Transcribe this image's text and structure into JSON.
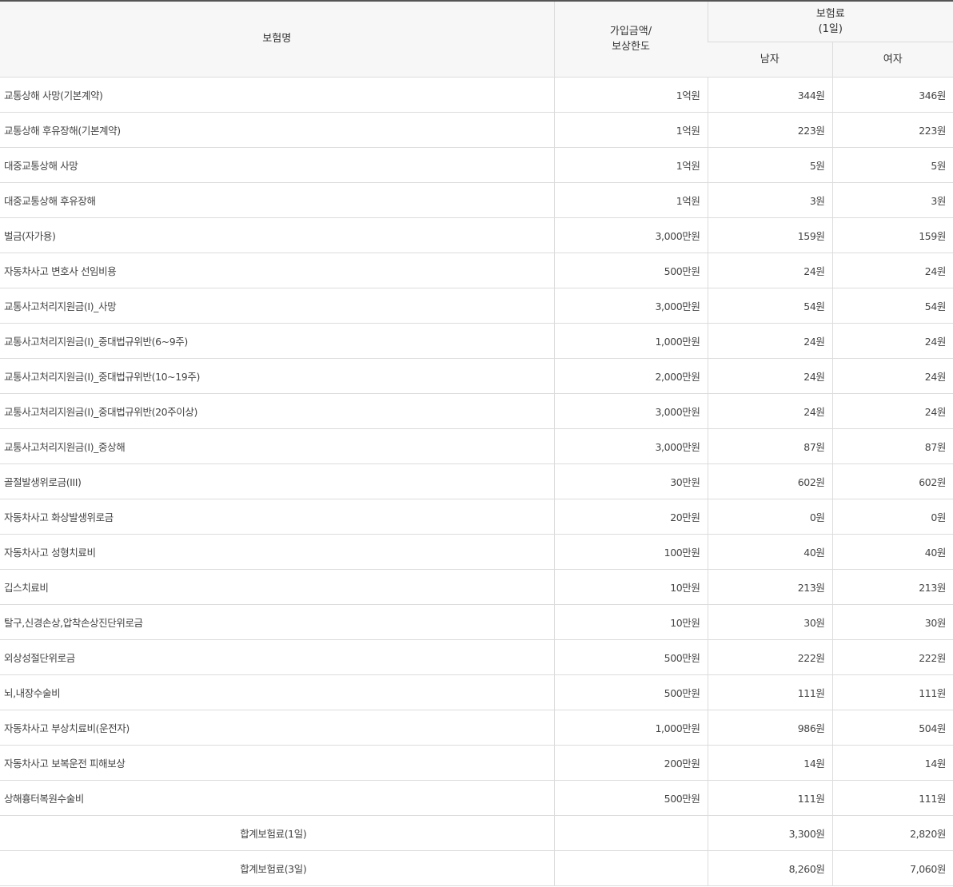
{
  "header": {
    "name": "보험명",
    "amount_line1": "가입금액/",
    "amount_line2": "보상한도",
    "premium_line1": "보험료",
    "premium_line2": "(1일)",
    "male": "남자",
    "female": "여자"
  },
  "rows": [
    {
      "name": "교통상해 사망(기본계약)",
      "amount": "1억원",
      "male": "344원",
      "female": "346원"
    },
    {
      "name": "교통상해 후유장해(기본계약)",
      "amount": "1억원",
      "male": "223원",
      "female": "223원"
    },
    {
      "name": "대중교통상해 사망",
      "amount": "1억원",
      "male": "5원",
      "female": "5원"
    },
    {
      "name": "대중교통상해 후유장해",
      "amount": "1억원",
      "male": "3원",
      "female": "3원"
    },
    {
      "name": "벌금(자가용)",
      "amount": "3,000만원",
      "male": "159원",
      "female": "159원"
    },
    {
      "name": "자동차사고 변호사 선임비용",
      "amount": "500만원",
      "male": "24원",
      "female": "24원"
    },
    {
      "name": "교통사고처리지원금(I)_사망",
      "amount": "3,000만원",
      "male": "54원",
      "female": "54원"
    },
    {
      "name": "교통사고처리지원금(I)_중대법규위반(6~9주)",
      "amount": "1,000만원",
      "male": "24원",
      "female": "24원"
    },
    {
      "name": "교통사고처리지원금(I)_중대법규위반(10~19주)",
      "amount": "2,000만원",
      "male": "24원",
      "female": "24원"
    },
    {
      "name": "교통사고처리지원금(I)_중대법규위반(20주이상)",
      "amount": "3,000만원",
      "male": "24원",
      "female": "24원"
    },
    {
      "name": "교통사고처리지원금(I)_중상해",
      "amount": "3,000만원",
      "male": "87원",
      "female": "87원"
    },
    {
      "name": "골절발생위로금(III)",
      "amount": "30만원",
      "male": "602원",
      "female": "602원"
    },
    {
      "name": "자동차사고 화상발생위로금",
      "amount": "20만원",
      "male": "0원",
      "female": "0원"
    },
    {
      "name": "자동차사고 성형치료비",
      "amount": "100만원",
      "male": "40원",
      "female": "40원"
    },
    {
      "name": "깁스치료비",
      "amount": "10만원",
      "male": "213원",
      "female": "213원"
    },
    {
      "name": "탈구,신경손상,압착손상진단위로금",
      "amount": "10만원",
      "male": "30원",
      "female": "30원"
    },
    {
      "name": "외상성절단위로금",
      "amount": "500만원",
      "male": "222원",
      "female": "222원"
    },
    {
      "name": "뇌,내장수술비",
      "amount": "500만원",
      "male": "111원",
      "female": "111원"
    },
    {
      "name": "자동차사고 부상치료비(운전자)",
      "amount": "1,000만원",
      "male": "986원",
      "female": "504원"
    },
    {
      "name": "자동차사고 보복운전 피해보상",
      "amount": "200만원",
      "male": "14원",
      "female": "14원"
    },
    {
      "name": "상해흉터복원수술비",
      "amount": "500만원",
      "male": "111원",
      "female": "111원"
    }
  ],
  "totals": [
    {
      "name": "합계보험료(1일)",
      "amount": "",
      "male": "3,300원",
      "female": "2,820원"
    },
    {
      "name": "합계보험료(3일)",
      "amount": "",
      "male": "8,260원",
      "female": "7,060원"
    }
  ]
}
